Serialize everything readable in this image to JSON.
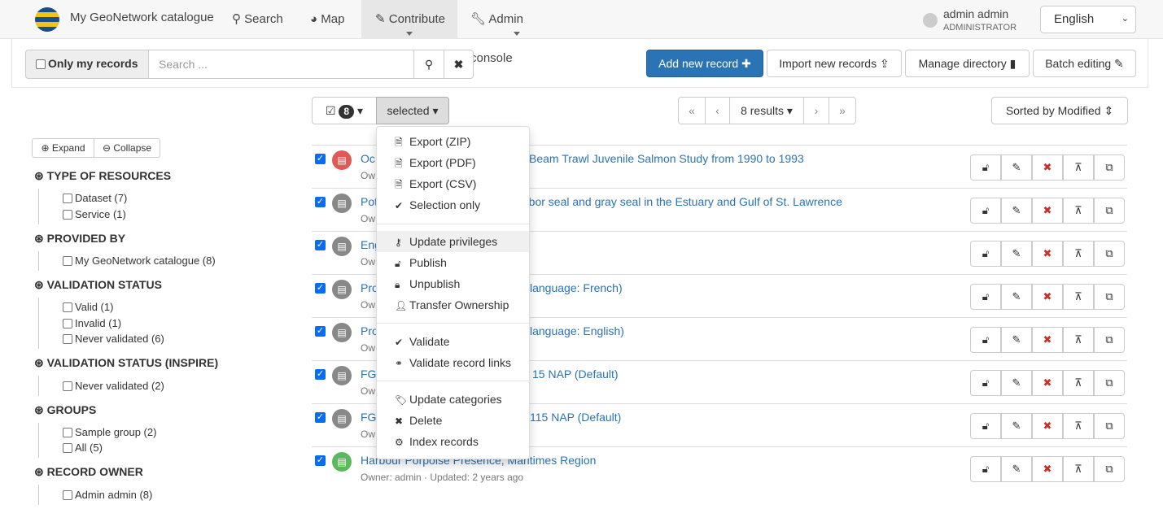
{
  "nav": {
    "brand": "My GeoNetwork catalogue",
    "items": [
      {
        "label": "Search",
        "icon": "search-icon"
      },
      {
        "label": "Map",
        "icon": "globe-icon"
      },
      {
        "label": "Contribute",
        "icon": "pencil-icon"
      },
      {
        "label": "Admin console",
        "icon": "wrench-icon"
      }
    ],
    "user_name": "admin admin",
    "user_role": "ADMINISTRATOR",
    "language": "English"
  },
  "toolbar": {
    "only_my_records": "Only my records",
    "search_placeholder": "Search ...",
    "add_new": "Add new record",
    "import": "Import new records",
    "manage_directory": "Manage directory",
    "batch_editing": "Batch editing"
  },
  "selection": {
    "count": "8",
    "selected_label": "selected",
    "results": "8 results",
    "sort": "Sorted by Modified"
  },
  "facets": {
    "expand": "Expand",
    "collapse": "Collapse",
    "groups": [
      {
        "title": "Type of resources",
        "items": [
          "Dataset (7)",
          "Service (1)"
        ]
      },
      {
        "title": "Provided by",
        "items": [
          "My GeoNetwork catalogue (8)"
        ]
      },
      {
        "title": "Validation status",
        "items": [
          "Valid (1)",
          "Invalid (1)",
          "Never validated (6)"
        ]
      },
      {
        "title": "Validation status (INSPIRE)",
        "items": [
          "Never validated (2)"
        ]
      },
      {
        "title": "Groups",
        "items": [
          "Sample group (2)",
          "All (5)"
        ]
      },
      {
        "title": "Record owner",
        "items": [
          "Admin admin (8)"
        ]
      }
    ]
  },
  "menu": {
    "items": [
      "Export (ZIP)",
      "Export (PDF)",
      "Export (CSV)",
      "Selection only",
      "Update privileges",
      "Publish",
      "Unpublish",
      "Transfer Ownership",
      "Validate",
      "Validate record links",
      "Update categories",
      "Delete",
      "Index records"
    ]
  },
  "records": [
    {
      "title_start": "Oc",
      "title_end": "Beam Trawl Juvenile Salmon Study from 1990 to 1993",
      "meta": "Ow",
      "color": "#e05a55"
    },
    {
      "title_start": "Pot",
      "title_end": "rbor seal and gray seal in the Estuary and Gulf of St. Lawrence",
      "meta": "Ow",
      "color": "#888888"
    },
    {
      "title_start": "Eng",
      "title_end": "",
      "meta": "Ow",
      "color": "#888888"
    },
    {
      "title_start": "Pro",
      "title_end": "language: French)",
      "meta": "Ow",
      "color": "#888888"
    },
    {
      "title_start": "Pro",
      "title_end": "language: English)",
      "meta": "Ow",
      "color": "#888888"
    },
    {
      "title_start": "FG",
      "title_end": "15 NAP (Default)",
      "meta": "Ow",
      "color": "#888888"
    },
    {
      "title_start": "FG",
      "title_end": "115 NAP (Default)",
      "meta": "Ow",
      "color": "#888888"
    },
    {
      "title_start": "Harbour Porpoise Presence, Maritimes Region",
      "title_end": "",
      "meta": "Owner: admin · Updated: 2 years ago",
      "color": "#5cb85c"
    }
  ]
}
